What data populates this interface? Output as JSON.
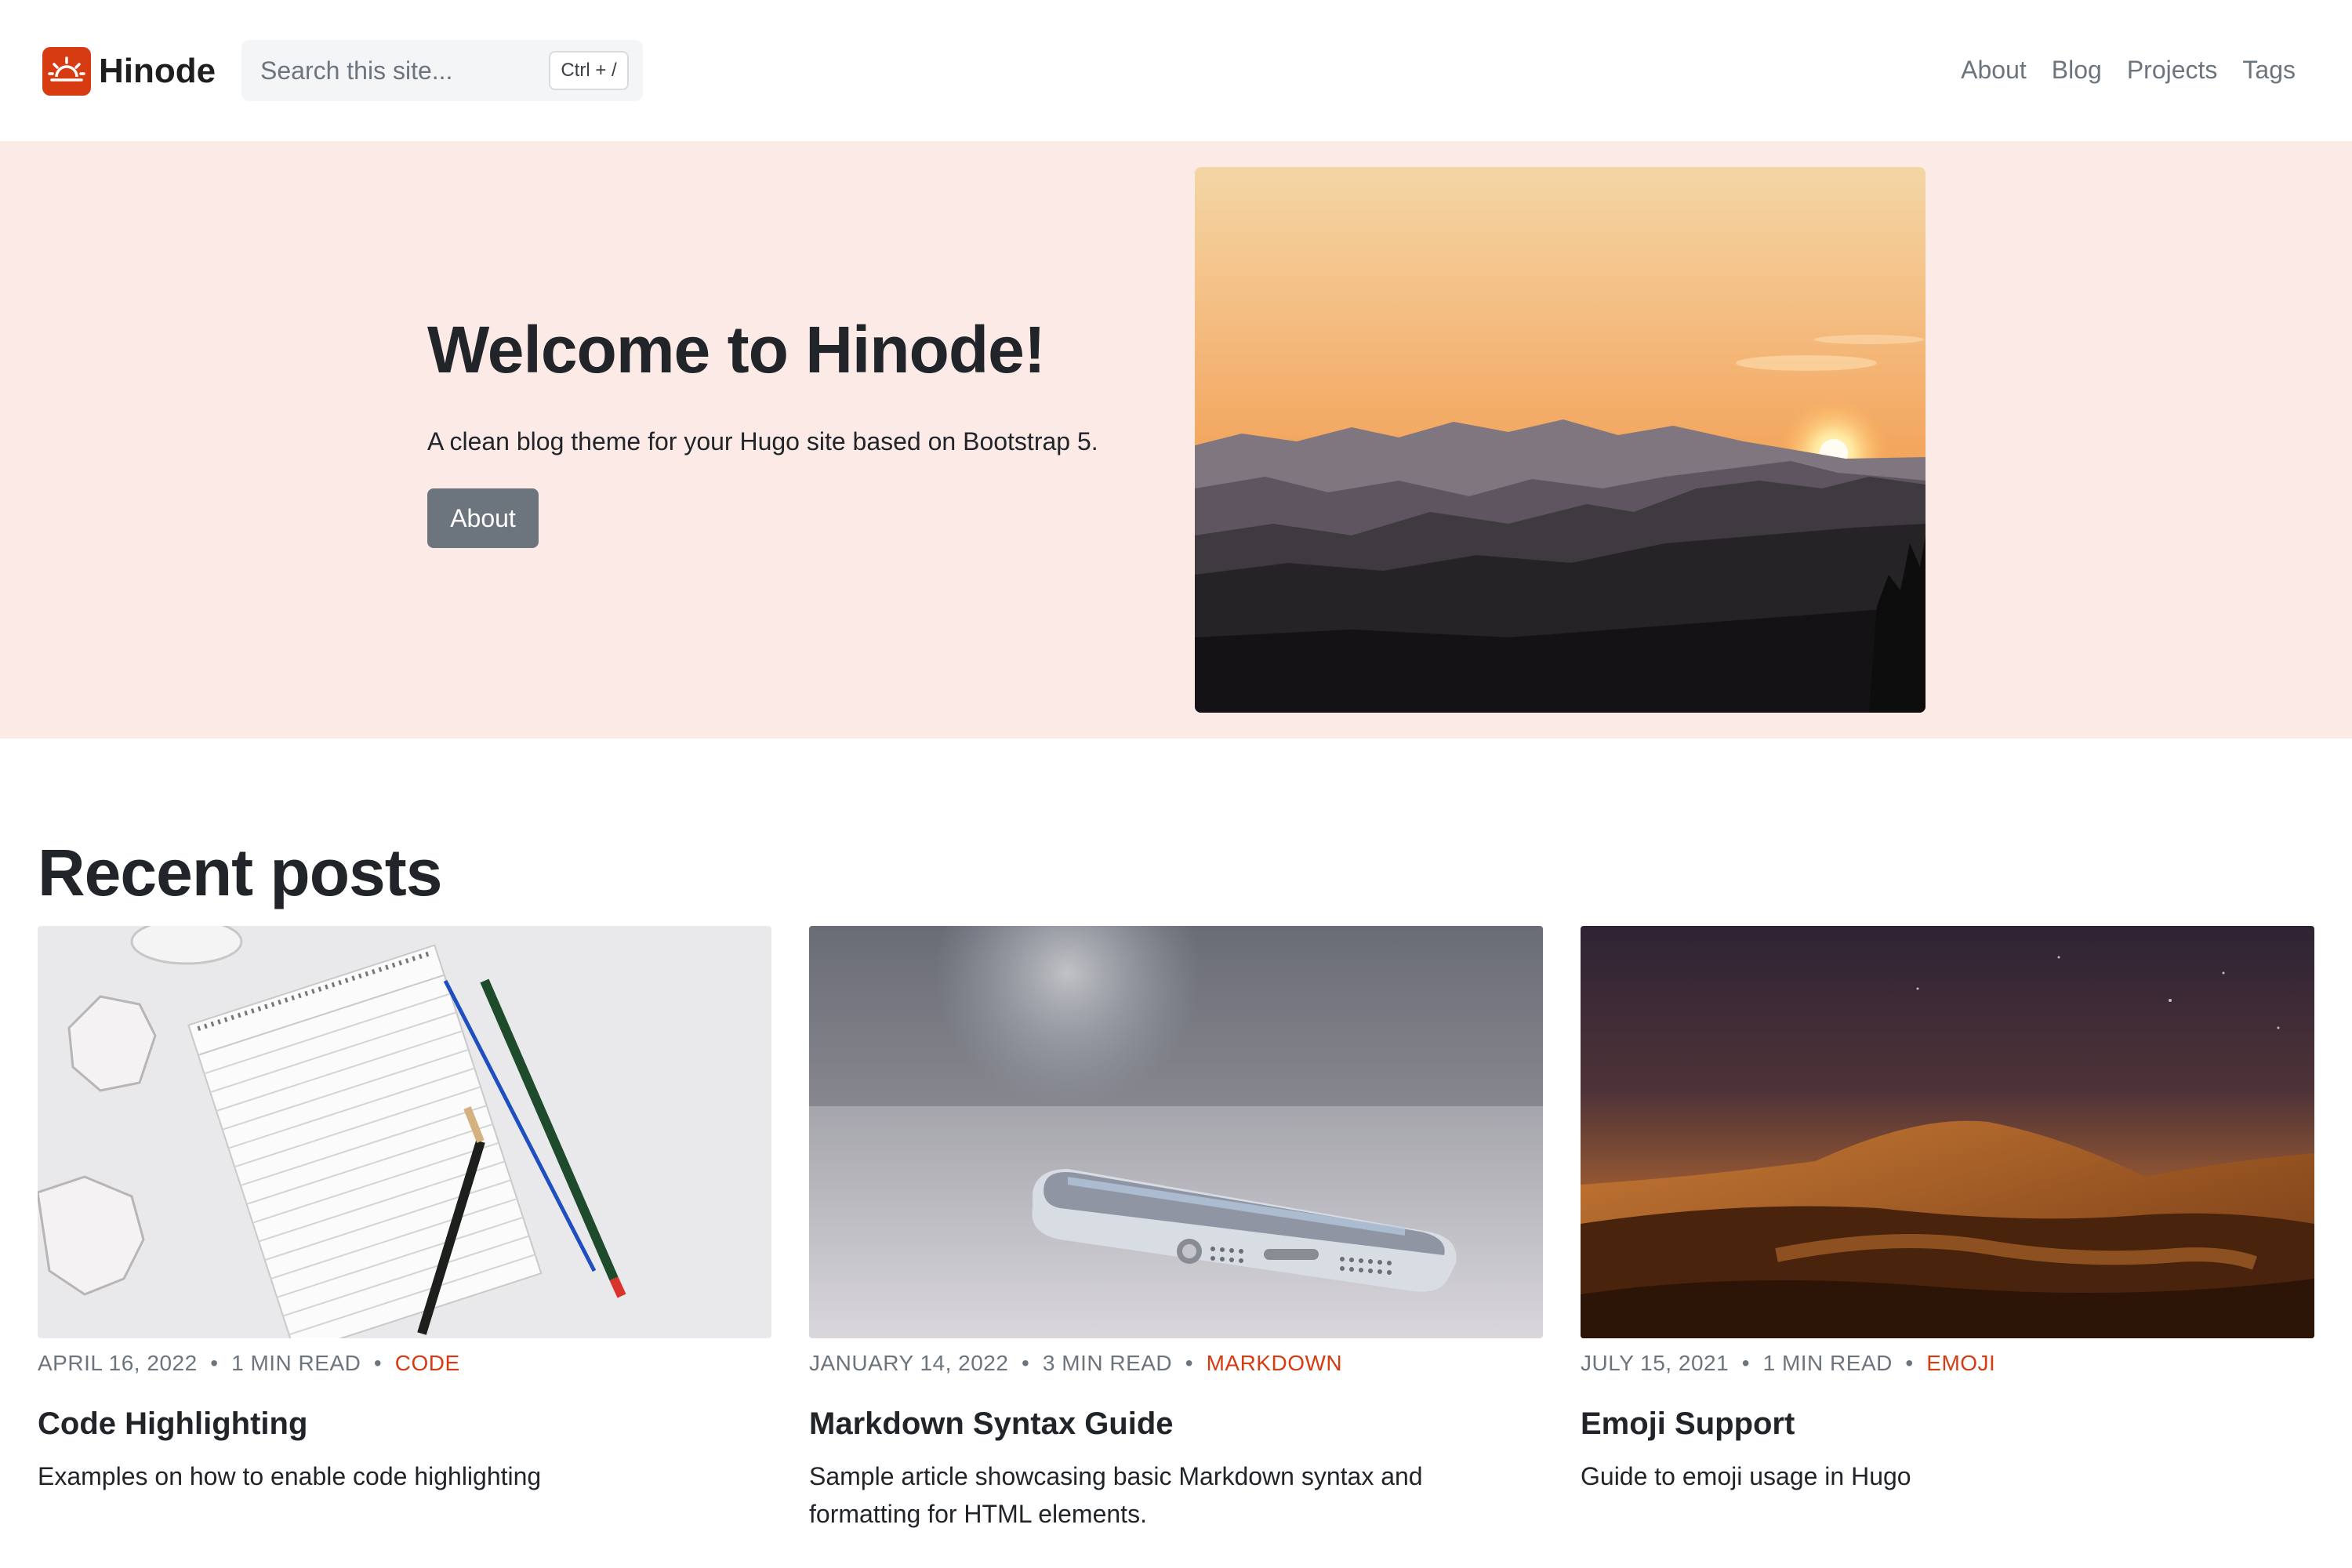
{
  "header": {
    "brand": "Hinode",
    "search_placeholder": "Search this site...",
    "search_shortcut": "Ctrl + /",
    "nav": [
      "About",
      "Blog",
      "Projects",
      "Tags"
    ]
  },
  "hero": {
    "title": "Welcome to Hinode!",
    "subtitle": "A clean blog theme for your Hugo site based on Bootstrap 5.",
    "button": "About"
  },
  "recent": {
    "title": "Recent posts",
    "posts": [
      {
        "date": "APRIL 16, 2022",
        "read": "1 MIN READ",
        "tag": "CODE",
        "title": "Code Highlighting",
        "desc": "Examples on how to enable code highlighting"
      },
      {
        "date": "JANUARY 14, 2022",
        "read": "3 MIN READ",
        "tag": "MARKDOWN",
        "title": "Markdown Syntax Guide",
        "desc": "Sample article showcasing basic Markdown syntax and formatting for HTML elements."
      },
      {
        "date": "JULY 15, 2021",
        "read": "1 MIN READ",
        "tag": "EMOJI",
        "title": "Emoji Support",
        "desc": "Guide to emoji usage in Hugo"
      }
    ]
  },
  "colors": {
    "accent": "#d63b12",
    "hero_bg": "#fceae7",
    "button_bg": "#6c757d",
    "muted_text": "#6c757d"
  }
}
